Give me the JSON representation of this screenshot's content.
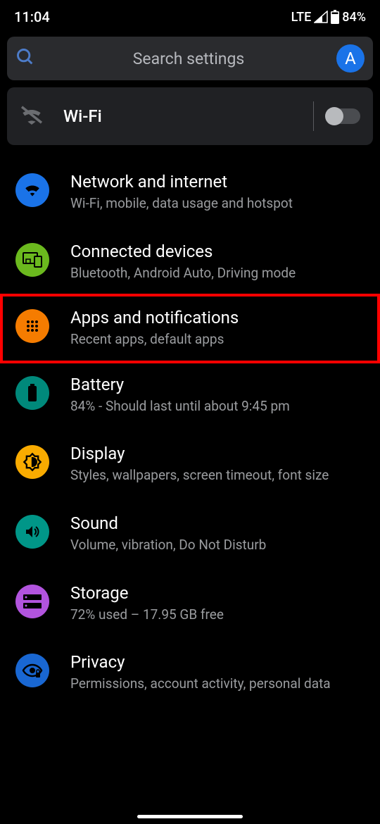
{
  "statusBar": {
    "time": "11:04",
    "network": "LTE",
    "battery": "84%"
  },
  "search": {
    "placeholder": "Search settings",
    "avatarLetter": "A"
  },
  "wifiCard": {
    "label": "Wi-Fi",
    "enabled": false
  },
  "settings": [
    {
      "id": "network",
      "title": "Network and internet",
      "subtitle": "Wi-Fi, mobile, data usage and hotspot",
      "iconClass": "icon-blue",
      "highlighted": false
    },
    {
      "id": "connected",
      "title": "Connected devices",
      "subtitle": "Bluetooth, Android Auto, Driving mode",
      "iconClass": "icon-green",
      "highlighted": false
    },
    {
      "id": "apps",
      "title": "Apps and notifications",
      "subtitle": "Recent apps, default apps",
      "iconClass": "icon-orange",
      "highlighted": true
    },
    {
      "id": "battery",
      "title": "Battery",
      "subtitle": "84% - Should last until about 9:45 pm",
      "iconClass": "icon-teal",
      "highlighted": false
    },
    {
      "id": "display",
      "title": "Display",
      "subtitle": "Styles, wallpapers, screen timeout, font size",
      "iconClass": "icon-amber",
      "highlighted": false
    },
    {
      "id": "sound",
      "title": "Sound",
      "subtitle": "Volume, vibration, Do Not Disturb",
      "iconClass": "icon-cyan",
      "highlighted": false
    },
    {
      "id": "storage",
      "title": "Storage",
      "subtitle": "72% used – 17.95 GB free",
      "iconClass": "icon-purple",
      "highlighted": false
    },
    {
      "id": "privacy",
      "title": "Privacy",
      "subtitle": "Permissions, account activity, personal data",
      "iconClass": "icon-blue2",
      "highlighted": false
    }
  ]
}
